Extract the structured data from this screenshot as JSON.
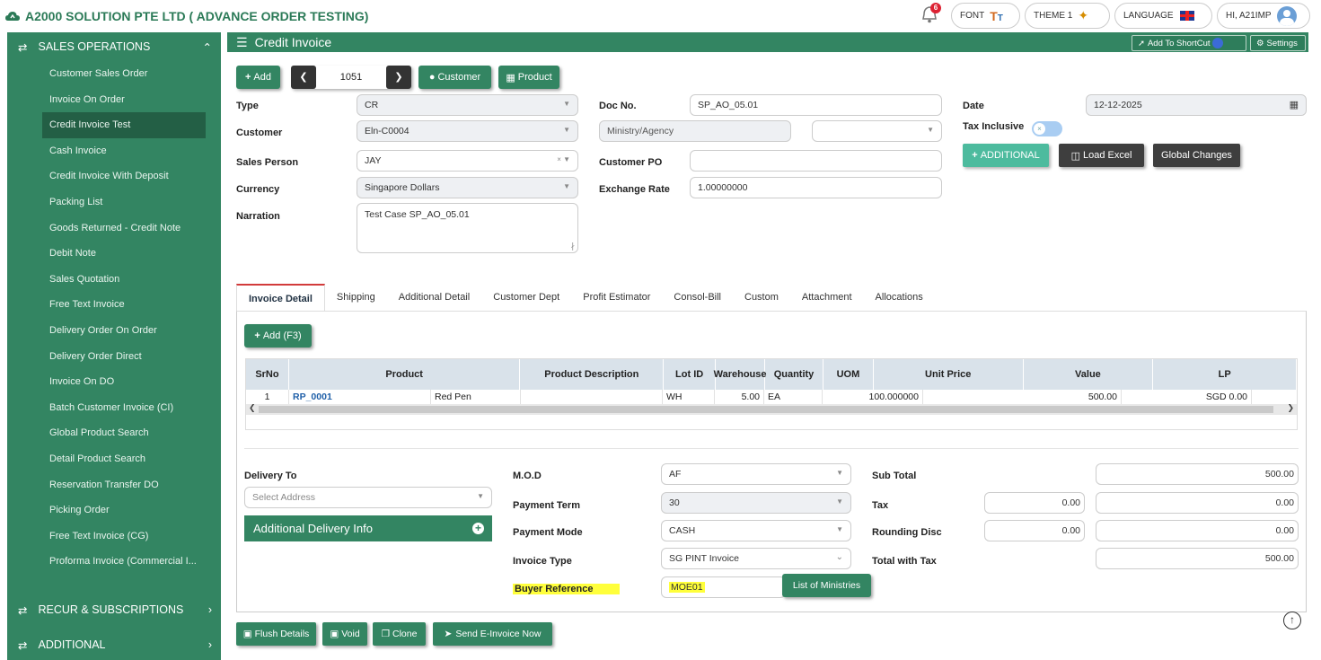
{
  "app": {
    "title": "A2000 SOLUTION PTE LTD ( ADVANCE ORDER TESTING)",
    "notif_count": "6",
    "font_label": "FONT",
    "theme_label": "THEME 1",
    "language_label": "LANGUAGE",
    "user_label": "HI, A21IMP"
  },
  "sidebar": {
    "section": "SALES OPERATIONS",
    "items": [
      "Customer Sales Order",
      "Invoice On Order",
      "Credit Invoice Test",
      "Cash Invoice",
      "Credit Invoice With Deposit",
      "Packing List",
      "Goods Returned - Credit Note",
      "Debit Note",
      "Sales Quotation",
      "Free Text Invoice",
      "Delivery Order On Order",
      "Delivery Order Direct",
      "Invoice On DO",
      "Batch Customer Invoice (CI)",
      "Global Product Search",
      "Detail Product Search",
      "Reservation Transfer DO",
      "Picking Order",
      "Free Text Invoice (CG)",
      "Proforma Invoice (Commercial I..."
    ],
    "footer1": "RECUR & SUBSCRIPTIONS",
    "footer2": "ADDITIONAL"
  },
  "page": {
    "title": "Credit Invoice",
    "shortcut_label": "Add To ShortCut",
    "settings_label": "Settings"
  },
  "toolbar": {
    "add": "Add",
    "number": "1051",
    "customer": "Customer",
    "product": "Product"
  },
  "form": {
    "type_label": "Type",
    "type_value": "CR",
    "customer_label": "Customer",
    "customer_value": "Eln-C0004",
    "salesperson_label": "Sales Person",
    "salesperson_value": "JAY",
    "currency_label": "Currency",
    "currency_value": "Singapore Dollars",
    "narration_label": "Narration",
    "narration_value": "Test Case SP_AO_05.01",
    "docno_label": "Doc No.",
    "docno_value": "SP_AO_05.01",
    "ministry_placeholder": "Ministry/Agency",
    "custpo_label": "Customer PO",
    "custpo_value": "",
    "exrate_label": "Exchange Rate",
    "exrate_value": "1.00000000",
    "date_label": "Date",
    "date_value": "12-12-2025",
    "taxincl_label": "Tax Inclusive",
    "additional_btn": "ADDITIONAL",
    "loadexcel_btn": "Load Excel",
    "global_btn": "Global Changes"
  },
  "tabs": [
    "Invoice Detail",
    "Shipping",
    "Additional Detail",
    "Customer Dept",
    "Profit Estimator",
    "Consol-Bill",
    "Custom",
    "Attachment",
    "Allocations"
  ],
  "grid": {
    "add_btn": "Add (F3)",
    "columns": [
      "SrNo",
      "Product",
      "Product Description",
      "Lot ID",
      "Warehouse",
      "Quantity",
      "UOM",
      "Unit Price",
      "Value",
      "LP"
    ],
    "rows": [
      {
        "srno": "1",
        "product": "RP_0001",
        "desc": "Red Pen",
        "lot": "",
        "wh": "WH",
        "qty": "5.00",
        "uom": "EA",
        "price": "100.000000",
        "value": "500.00",
        "lp": "SGD 0.00"
      }
    ]
  },
  "footer": {
    "delivery_label": "Delivery To",
    "delivery_placeholder": "Select Address",
    "add_delivery": "Additional Delivery Info",
    "mod_label": "M.O.D",
    "mod_value": "AF",
    "payterm_label": "Payment Term",
    "payterm_value": "30",
    "paymode_label": "Payment Mode",
    "paymode_value": "CASH",
    "invtype_label": "Invoice Type",
    "invtype_value": "SG PINT Invoice",
    "buyer_label": "Buyer Reference",
    "buyer_value": "MOE01",
    "ministries_btn": "List of Ministries",
    "subtotal_label": "Sub Total",
    "subtotal_value": "500.00",
    "tax_label": "Tax",
    "tax_value1": "0.00",
    "tax_value2": "0.00",
    "rounding_label": "Rounding Disc",
    "rounding_value1": "0.00",
    "rounding_value2": "0.00",
    "totaltax_label": "Total with Tax",
    "totaltax_value": "500.00"
  },
  "actions": {
    "flush": "Flush Details",
    "void": "Void",
    "clone": "Clone",
    "einvoice": "Send E-Invoice Now"
  }
}
